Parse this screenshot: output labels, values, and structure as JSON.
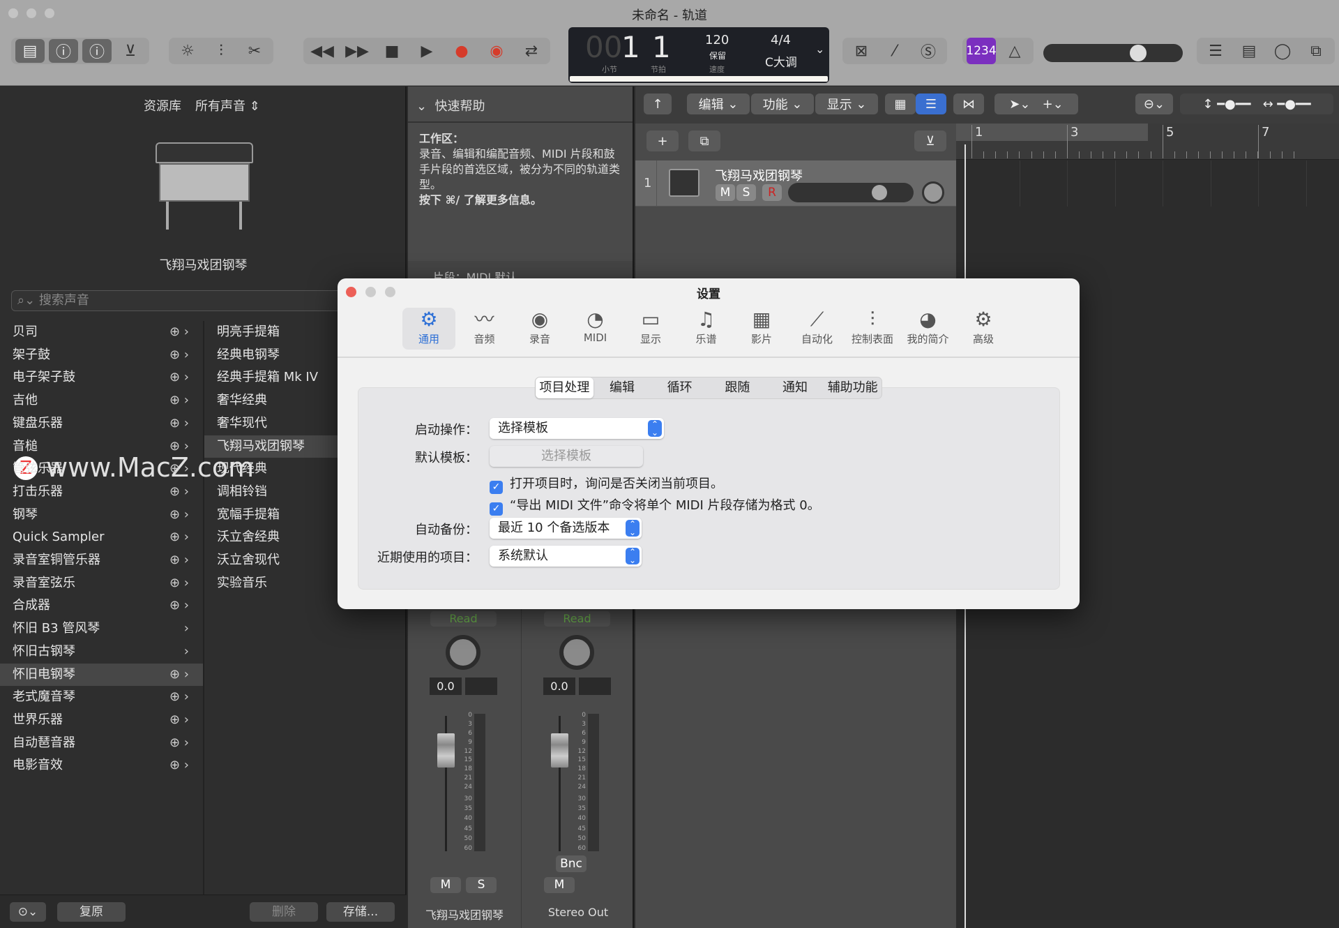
{
  "window": {
    "title": "未命名 - 轨道"
  },
  "toolbar": {
    "icons_left": [
      "library-icon",
      "info-icon",
      "help-icon",
      "download-icon"
    ],
    "icons_mid": [
      "brightness-icon",
      "mixer-icon",
      "scissors-icon"
    ],
    "transport": [
      "rewind-icon",
      "fast-forward-icon",
      "stop-icon",
      "play-icon",
      "record-icon",
      "capture-record-icon",
      "cycle-icon"
    ],
    "lcd": {
      "bar": "001",
      "beat": "1",
      "bar_label": "小节",
      "beat_label": "节拍",
      "tempo": "120",
      "tempo_mode": "保留",
      "tempo_label": "速度",
      "signature": "4/4",
      "key": "C大调"
    },
    "count_in": "1234",
    "accent": "#7b2fbf"
  },
  "library": {
    "header": "资源库",
    "filter": "所有声音",
    "instrument_name": "飞翔马戏团钢琴",
    "search_placeholder": "搜索声音",
    "categories": [
      "贝司",
      "架子鼓",
      "电子架子鼓",
      "吉他",
      "键盘乐器",
      "音槌",
      "管弦乐器",
      "打击乐器",
      "钢琴",
      "Quick Sampler",
      "录音室铜管乐器",
      "录音室弦乐",
      "合成器",
      "怀旧 B3 管风琴",
      "怀旧古钢琴",
      "怀旧电钢琴",
      "老式魔音琴",
      "世界乐器",
      "自动琶音器",
      "电影音效"
    ],
    "selected_category": "怀旧电钢琴",
    "patches": [
      "明亮手提箱",
      "经典电钢琴",
      "经典手提箱 Mk IV",
      "奢华经典",
      "奢华现代",
      "飞翔马戏团钢琴",
      "现代经典",
      "调相铃铛",
      "宽幅手提箱",
      "沃立舍经典",
      "沃立舍现代",
      "实验音乐"
    ],
    "selected_patch": "飞翔马戏团钢琴",
    "footer": {
      "revert": "复原",
      "delete": "删除",
      "save": "存储..."
    }
  },
  "watermark": "www.MacZ.com",
  "quick_help": {
    "title": "快速帮助",
    "heading": "工作区：",
    "body": "录音、编辑和编配音频、MIDI 片段和鼓手片段的首选区域，被分为不同的轨道类型。",
    "shortcut": "按下 ⌘/ 了解更多信息。",
    "section2": "片段：MIDI 默认"
  },
  "tracks": {
    "menus": [
      "编辑",
      "功能",
      "显示"
    ],
    "track": {
      "number": "1",
      "name": "飞翔马戏团钢琴",
      "mute": "M",
      "solo": "S",
      "rec": "R"
    },
    "ruler": [
      "1",
      "3",
      "5",
      "7"
    ]
  },
  "mixer": {
    "strips": [
      {
        "automation": "Read",
        "gain": "0.0",
        "name": "飞翔马戏团钢琴",
        "buttons": [
          "M",
          "S"
        ]
      },
      {
        "automation": "Read",
        "gain": "0.0",
        "name": "Stereo Out",
        "buttons": [
          "M"
        ],
        "extra": "Bnc"
      }
    ],
    "scale": [
      "0",
      "3",
      "6",
      "9",
      "12",
      "15",
      "18",
      "21",
      "24",
      "30",
      "35",
      "40",
      "45",
      "50",
      "60"
    ]
  },
  "settings": {
    "title": "设置",
    "tabs": [
      {
        "label": "通用",
        "icon": "gear-icon"
      },
      {
        "label": "音频",
        "icon": "waveform-icon"
      },
      {
        "label": "录音",
        "icon": "record-icon"
      },
      {
        "label": "MIDI",
        "icon": "midi-icon"
      },
      {
        "label": "显示",
        "icon": "display-icon"
      },
      {
        "label": "乐谱",
        "icon": "notes-icon"
      },
      {
        "label": "影片",
        "icon": "film-icon"
      },
      {
        "label": "自动化",
        "icon": "automation-icon"
      },
      {
        "label": "控制表面",
        "icon": "sliders-icon"
      },
      {
        "label": "我的简介",
        "icon": "profile-icon"
      },
      {
        "label": "高级",
        "icon": "gears-icon"
      }
    ],
    "active_tab": "通用",
    "subtabs": [
      "项目处理",
      "编辑",
      "循环",
      "跟随",
      "通知",
      "辅助功能"
    ],
    "active_subtab": "项目处理",
    "startup_label": "启动操作：",
    "startup_value": "选择模板",
    "default_template_label": "默认模板：",
    "default_template_button": "选择模板",
    "check1": "打开项目时，询问是否关闭当前项目。",
    "check1_checked": true,
    "check2": "“导出 MIDI 文件”命令将单个 MIDI 片段存储为格式 0。",
    "check2_checked": true,
    "backup_label": "自动备份：",
    "backup_value": "最近 10 个备选版本",
    "recent_label": "近期使用的项目：",
    "recent_value": "系统默认"
  }
}
